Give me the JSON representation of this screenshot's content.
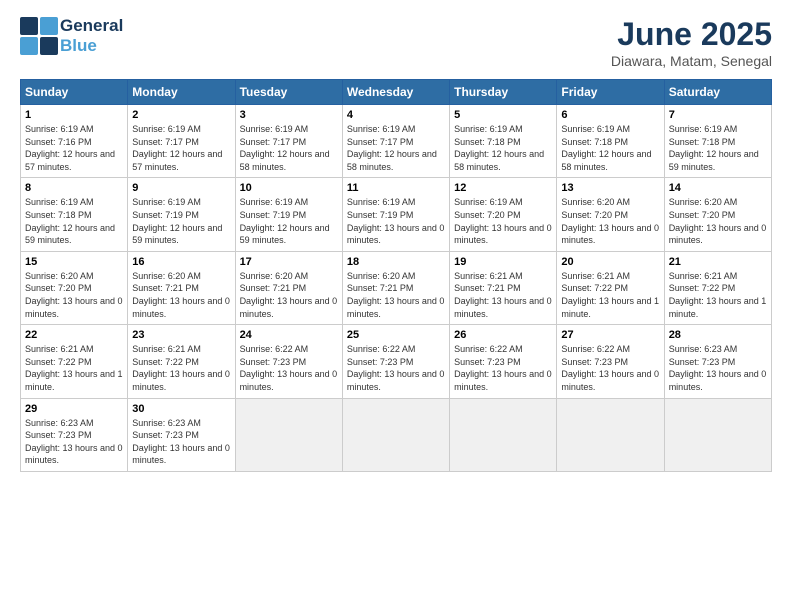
{
  "logo": {
    "line1": "General",
    "line2": "Blue"
  },
  "title": "June 2025",
  "subtitle": "Diawara, Matam, Senegal",
  "headers": [
    "Sunday",
    "Monday",
    "Tuesday",
    "Wednesday",
    "Thursday",
    "Friday",
    "Saturday"
  ],
  "days": [
    {
      "num": "",
      "info": ""
    },
    {
      "num": "",
      "info": ""
    },
    {
      "num": "",
      "info": ""
    },
    {
      "num": "",
      "info": ""
    },
    {
      "num": "",
      "info": ""
    },
    {
      "num": "",
      "info": ""
    },
    {
      "num": "1",
      "sunrise": "Sunrise: 6:19 AM",
      "sunset": "Sunset: 7:16 PM",
      "daylight": "Daylight: 12 hours and 57 minutes."
    },
    {
      "num": "2",
      "sunrise": "Sunrise: 6:19 AM",
      "sunset": "Sunset: 7:17 PM",
      "daylight": "Daylight: 12 hours and 57 minutes."
    },
    {
      "num": "3",
      "sunrise": "Sunrise: 6:19 AM",
      "sunset": "Sunset: 7:17 PM",
      "daylight": "Daylight: 12 hours and 58 minutes."
    },
    {
      "num": "4",
      "sunrise": "Sunrise: 6:19 AM",
      "sunset": "Sunset: 7:17 PM",
      "daylight": "Daylight: 12 hours and 58 minutes."
    },
    {
      "num": "5",
      "sunrise": "Sunrise: 6:19 AM",
      "sunset": "Sunset: 7:18 PM",
      "daylight": "Daylight: 12 hours and 58 minutes."
    },
    {
      "num": "6",
      "sunrise": "Sunrise: 6:19 AM",
      "sunset": "Sunset: 7:18 PM",
      "daylight": "Daylight: 12 hours and 58 minutes."
    },
    {
      "num": "7",
      "sunrise": "Sunrise: 6:19 AM",
      "sunset": "Sunset: 7:18 PM",
      "daylight": "Daylight: 12 hours and 59 minutes."
    },
    {
      "num": "8",
      "sunrise": "Sunrise: 6:19 AM",
      "sunset": "Sunset: 7:18 PM",
      "daylight": "Daylight: 12 hours and 59 minutes."
    },
    {
      "num": "9",
      "sunrise": "Sunrise: 6:19 AM",
      "sunset": "Sunset: 7:19 PM",
      "daylight": "Daylight: 12 hours and 59 minutes."
    },
    {
      "num": "10",
      "sunrise": "Sunrise: 6:19 AM",
      "sunset": "Sunset: 7:19 PM",
      "daylight": "Daylight: 12 hours and 59 minutes."
    },
    {
      "num": "11",
      "sunrise": "Sunrise: 6:19 AM",
      "sunset": "Sunset: 7:19 PM",
      "daylight": "Daylight: 13 hours and 0 minutes."
    },
    {
      "num": "12",
      "sunrise": "Sunrise: 6:19 AM",
      "sunset": "Sunset: 7:20 PM",
      "daylight": "Daylight: 13 hours and 0 minutes."
    },
    {
      "num": "13",
      "sunrise": "Sunrise: 6:20 AM",
      "sunset": "Sunset: 7:20 PM",
      "daylight": "Daylight: 13 hours and 0 minutes."
    },
    {
      "num": "14",
      "sunrise": "Sunrise: 6:20 AM",
      "sunset": "Sunset: 7:20 PM",
      "daylight": "Daylight: 13 hours and 0 minutes."
    },
    {
      "num": "15",
      "sunrise": "Sunrise: 6:20 AM",
      "sunset": "Sunset: 7:20 PM",
      "daylight": "Daylight: 13 hours and 0 minutes."
    },
    {
      "num": "16",
      "sunrise": "Sunrise: 6:20 AM",
      "sunset": "Sunset: 7:21 PM",
      "daylight": "Daylight: 13 hours and 0 minutes."
    },
    {
      "num": "17",
      "sunrise": "Sunrise: 6:20 AM",
      "sunset": "Sunset: 7:21 PM",
      "daylight": "Daylight: 13 hours and 0 minutes."
    },
    {
      "num": "18",
      "sunrise": "Sunrise: 6:20 AM",
      "sunset": "Sunset: 7:21 PM",
      "daylight": "Daylight: 13 hours and 0 minutes."
    },
    {
      "num": "19",
      "sunrise": "Sunrise: 6:21 AM",
      "sunset": "Sunset: 7:21 PM",
      "daylight": "Daylight: 13 hours and 0 minutes."
    },
    {
      "num": "20",
      "sunrise": "Sunrise: 6:21 AM",
      "sunset": "Sunset: 7:22 PM",
      "daylight": "Daylight: 13 hours and 1 minute."
    },
    {
      "num": "21",
      "sunrise": "Sunrise: 6:21 AM",
      "sunset": "Sunset: 7:22 PM",
      "daylight": "Daylight: 13 hours and 1 minute."
    },
    {
      "num": "22",
      "sunrise": "Sunrise: 6:21 AM",
      "sunset": "Sunset: 7:22 PM",
      "daylight": "Daylight: 13 hours and 1 minute."
    },
    {
      "num": "23",
      "sunrise": "Sunrise: 6:21 AM",
      "sunset": "Sunset: 7:22 PM",
      "daylight": "Daylight: 13 hours and 0 minutes."
    },
    {
      "num": "24",
      "sunrise": "Sunrise: 6:22 AM",
      "sunset": "Sunset: 7:23 PM",
      "daylight": "Daylight: 13 hours and 0 minutes."
    },
    {
      "num": "25",
      "sunrise": "Sunrise: 6:22 AM",
      "sunset": "Sunset: 7:23 PM",
      "daylight": "Daylight: 13 hours and 0 minutes."
    },
    {
      "num": "26",
      "sunrise": "Sunrise: 6:22 AM",
      "sunset": "Sunset: 7:23 PM",
      "daylight": "Daylight: 13 hours and 0 minutes."
    },
    {
      "num": "27",
      "sunrise": "Sunrise: 6:22 AM",
      "sunset": "Sunset: 7:23 PM",
      "daylight": "Daylight: 13 hours and 0 minutes."
    },
    {
      "num": "28",
      "sunrise": "Sunrise: 6:23 AM",
      "sunset": "Sunset: 7:23 PM",
      "daylight": "Daylight: 13 hours and 0 minutes."
    },
    {
      "num": "29",
      "sunrise": "Sunrise: 6:23 AM",
      "sunset": "Sunset: 7:23 PM",
      "daylight": "Daylight: 13 hours and 0 minutes."
    },
    {
      "num": "30",
      "sunrise": "Sunrise: 6:23 AM",
      "sunset": "Sunset: 7:23 PM",
      "daylight": "Daylight: 13 hours and 0 minutes."
    }
  ]
}
